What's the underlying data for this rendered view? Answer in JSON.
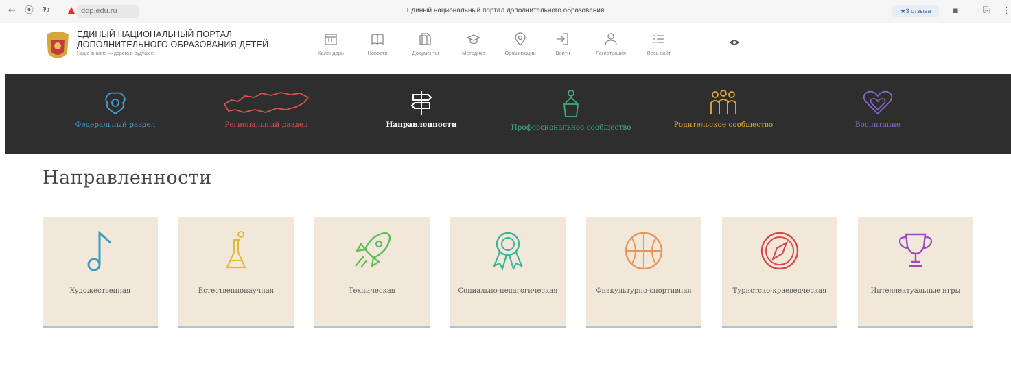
{
  "browser": {
    "url": "dop.edu.ru",
    "page_title": "Единый национальный портал дополнительного образования",
    "reviews": "★3 отзыва"
  },
  "header": {
    "brand_line1": "ЕДИНЫЙ НАЦИОНАЛЬНЫЙ ПОРТАЛ",
    "brand_line2": "ДОПОЛНИТЕЛЬНОГО ОБРАЗОВАНИЯ ДЕТЕЙ",
    "tagline": "Наше знание — дорога в будущее",
    "nav": [
      {
        "label": "Календарь",
        "icon": "calendar-icon"
      },
      {
        "label": "Новости",
        "icon": "news-icon"
      },
      {
        "label": "Документы",
        "icon": "documents-icon"
      },
      {
        "label": "Методика",
        "icon": "graduation-cap-icon"
      },
      {
        "label": "Организации",
        "icon": "map-pin-icon"
      },
      {
        "label": "Войти",
        "icon": "login-icon"
      },
      {
        "label": "Регистрация",
        "icon": "user-icon"
      },
      {
        "label": "Весь сайт",
        "icon": "menu-list-icon"
      }
    ]
  },
  "sections": [
    {
      "label": "Федеральный раздел",
      "color": "#4a9fd0",
      "icon": "eagle-emblem-icon"
    },
    {
      "label": "Региональный раздел",
      "color": "#d9534f",
      "icon": "russia-map-icon"
    },
    {
      "label": "Направленности",
      "color": "#ffffff",
      "icon": "signpost-icon"
    },
    {
      "label": "Профессиональное сообщество",
      "color": "#3fae7f",
      "icon": "teacher-icon"
    },
    {
      "label": "Родительское сообщество",
      "color": "#e8a838",
      "icon": "family-icon"
    },
    {
      "label": "Воспитание",
      "color": "#8a6ac8",
      "icon": "heart-icon"
    }
  ],
  "main": {
    "title": "Направленности",
    "cards": [
      {
        "label": "Художественная",
        "color": "#3a9ac9",
        "icon": "music-note-icon"
      },
      {
        "label": "Естественнонаучная",
        "color": "#e3b93a",
        "icon": "flask-icon"
      },
      {
        "label": "Техническая",
        "color": "#5dbb5a",
        "icon": "rocket-icon"
      },
      {
        "label": "Социально-педагогическая",
        "color": "#3ab59a",
        "icon": "award-ribbon-icon"
      },
      {
        "label": "Физкультурно-спортивная",
        "color": "#e8955a",
        "icon": "basketball-icon"
      },
      {
        "label": "Туристско-краеведческая",
        "color": "#d84a4a",
        "icon": "compass-icon"
      },
      {
        "label": "Интеллектуальные игры",
        "color": "#9b4ac2",
        "icon": "trophy-icon"
      }
    ]
  }
}
